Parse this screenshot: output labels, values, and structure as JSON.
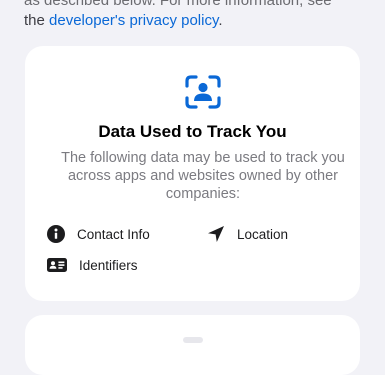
{
  "intro": {
    "partial_line": "as described below. For more information, see",
    "prefix": "the ",
    "link_text": "developer's privacy policy",
    "suffix": "."
  },
  "card": {
    "icon": "face-scan-icon",
    "title": "Data Used to Track You",
    "description": "The following data may be used to track you across apps and websites owned by other companies:",
    "items": [
      {
        "icon": "info-circle-icon",
        "label": "Contact Info"
      },
      {
        "icon": "location-arrow-icon",
        "label": "Location"
      },
      {
        "icon": "id-card-icon",
        "label": "Identifiers"
      }
    ]
  },
  "colors": {
    "background": "#f2f2f7",
    "card": "#ffffff",
    "accent": "#0a68d6",
    "secondary_text": "#7b7b81"
  }
}
